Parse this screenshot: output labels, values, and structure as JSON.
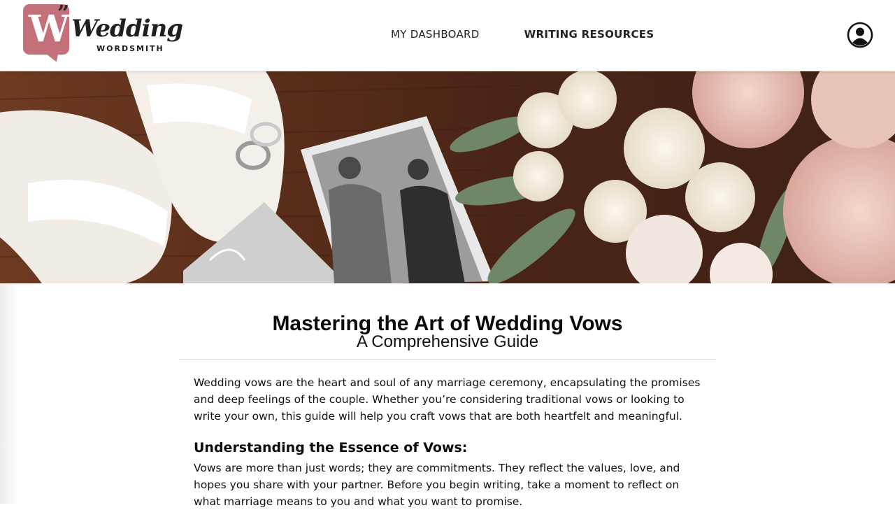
{
  "brand": {
    "logo_letter": "W",
    "logo_quote": "”",
    "logo_word": "Wedding",
    "logo_sub": "WORDSMITH",
    "accent_color": "#c4707a"
  },
  "nav": {
    "items": [
      {
        "label": "MY DASHBOARD",
        "active": false
      },
      {
        "label": "WRITING RESOURCES",
        "active": true
      }
    ]
  },
  "header": {
    "account_icon": "user-circle-icon"
  },
  "hero": {
    "description_icon": "photo"
  },
  "article": {
    "title": "Mastering the Art of Wedding Vows",
    "subtitle": "A Comprehensive Guide",
    "intro": "Wedding vows are the heart and soul of any marriage ceremony, encapsulating the promises and deep feelings of the couple. Whether you’re considering traditional vows or looking to write your own, this guide will help you craft vows that are both heartfelt and meaningful.",
    "section_heading": "Understanding the Essence of Vows:",
    "section_body": "Vows are more than just words; they are commitments. They reflect the values, love, and hopes you share with your partner. Before you begin writing, take a moment to reflect on what marriage means to you and what you want to promise."
  }
}
